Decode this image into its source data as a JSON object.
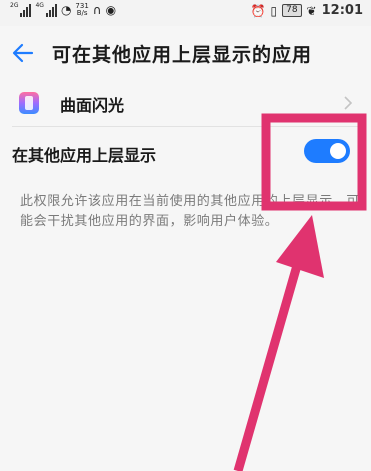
{
  "status_bar": {
    "net1_label": "2G",
    "net2_label": "4G",
    "speed_value": "731",
    "speed_unit": "B/s",
    "battery": "78",
    "time": "12:01"
  },
  "header": {
    "title": "可在其他应用上层显示的应用"
  },
  "app_row": {
    "name": "曲面闪光"
  },
  "switch_row": {
    "label": "在其他应用上层显示",
    "enabled": true
  },
  "description": "此权限允许该应用在当前使用的其他应用的上层显示，可能会干扰其他应用的界面，影响用户体验。",
  "colors": {
    "toggle_on": "#1e7cff",
    "annotation": "#e0336f"
  },
  "icons": {
    "back": "back-arrow-icon",
    "app": "edge-lighting-app-icon",
    "chevron": "chevron-right-icon"
  }
}
